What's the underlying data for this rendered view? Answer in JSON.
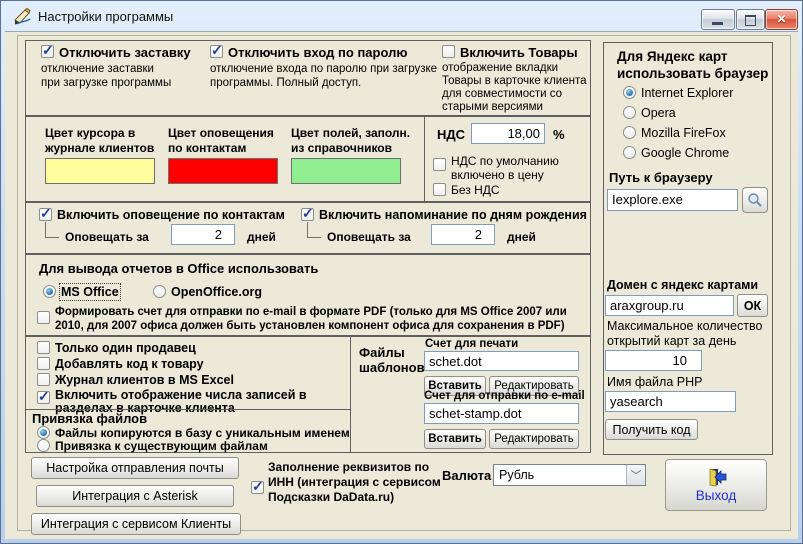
{
  "window": {
    "title": "Настройки программы",
    "controls": {
      "minimize": "minimize",
      "maximize": "maximize",
      "close": "close"
    }
  },
  "colors": {
    "cursor_swatch": "#ffff9e",
    "alert_swatch": "#fe0000",
    "fields_swatch": "#90ee90",
    "exit_text": "#2230cc"
  },
  "top": {
    "screensaver": {
      "label": "Отключить заставку",
      "desc": "отключение заставки\nпри загрузке программы",
      "checked": true
    },
    "password": {
      "label": "Отключить вход по паролю",
      "desc": "отключение входа по паролю при загрузке\nпрограммы. Полный доступ.",
      "checked": true
    },
    "goods": {
      "label": "Включить Товары",
      "desc": "отображение вкладки\nТовары в карточке клиента\nдля совместимости со\nстарыми версиями",
      "checked": false
    }
  },
  "yandex_browser": {
    "title": "Для Яндекс карт\nиспользовать браузер",
    "options": [
      {
        "label": "Internet Explorer",
        "selected": true
      },
      {
        "label": "Opera",
        "selected": false
      },
      {
        "label": "Mozilla FireFox",
        "selected": false
      },
      {
        "label": "Google Chrome",
        "selected": false
      }
    ],
    "path_label": "Путь к браузеру",
    "path_value": "Iexplore.exe"
  },
  "swatches": [
    {
      "label": "Цвет курсора в\nжурнале клиентов"
    },
    {
      "label": "Цвет оповещения\nпо контактам"
    },
    {
      "label": "Цвет полей, заполн.\nиз справочников"
    }
  ],
  "vat": {
    "label": "НДС",
    "value": "18,00",
    "unit": "%",
    "include_label": "НДС по умолчанию\nвключено в цену",
    "include_checked": false,
    "novat_label": "Без НДС",
    "novat_checked": false
  },
  "notify": {
    "contacts": {
      "label": "Включить оповещение по контактам",
      "checked": true,
      "prefix": "Оповещать за",
      "value": "2",
      "suffix": "дней"
    },
    "birthday": {
      "label": "Включить напоминание по дням рождения",
      "checked": true,
      "prefix": "Оповещать за",
      "value": "2",
      "suffix": "дней"
    }
  },
  "office": {
    "title": "Для вывода отчетов в Office использовать",
    "options": [
      {
        "label": "MS Office",
        "selected": true
      },
      {
        "label": "OpenOffice.org",
        "selected": false
      }
    ],
    "pdf_label": "Формировать счет для отправки по e-mail в формате PDF (только для MS Office 2007 или\n2010, для 2007 офиса должен быть установлен компонент офиса для  сохранения в PDF)",
    "pdf_checked": false
  },
  "flags": [
    {
      "label": "Только один продавец",
      "checked": false
    },
    {
      "label": "Добавлять код к товару",
      "checked": false
    },
    {
      "label": "Журнал клиентов в MS Excel",
      "checked": false
    },
    {
      "label": "Включить отображение числа записей в\nразделах в карточке клиента",
      "checked": true
    }
  ],
  "file_binding": {
    "title": "Привязка файлов",
    "options": [
      {
        "label": "Файлы копируются в базу с уникальным именем",
        "selected": true
      },
      {
        "label": "Привязка к существующим файлам",
        "selected": false
      }
    ]
  },
  "templates": {
    "title": "Файлы\nшаблонов",
    "print": {
      "label": "Счет для печати",
      "value": "schet.dot",
      "insert": "Вставить",
      "edit": "Редактировать"
    },
    "email": {
      "label": "Счет для отправки по e-mail",
      "value": "schet-stamp.dot",
      "insert": "Вставить",
      "edit": "Редактировать"
    }
  },
  "maps": {
    "domain_label": "Домен с яндекс картами",
    "domain_value": "araxgroup.ru",
    "ok": "ОК",
    "max_label": "Максимальное количество\nоткрытий карт за день",
    "max_value": "10",
    "php_label": "Имя файла PHP",
    "php_value": "yasearch",
    "get_code": "Получить код"
  },
  "bottom": {
    "mail_button": "Настройка отправления почты",
    "asterisk_button": "Интеграция с Asterisk",
    "clients_button": "Интеграция с сервисом Клиенты",
    "inn_label": "Заполнение реквизитов по\nИНН (интеграция с сервисом\nПодсказки DaData.ru)",
    "inn_checked": true,
    "currency_label": "Валюта",
    "currency_value": "Рубль",
    "exit_button": "Выход"
  }
}
